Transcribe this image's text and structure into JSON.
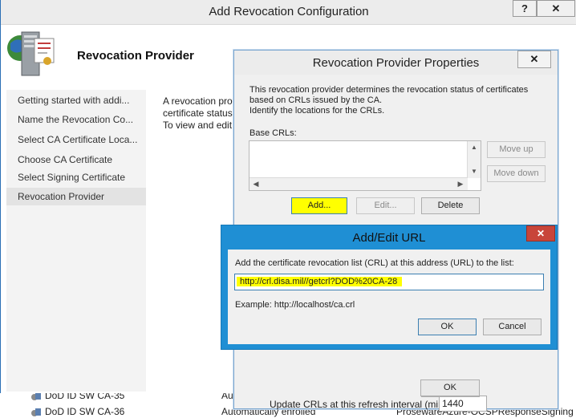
{
  "background_list": {
    "rows": [
      {
        "name": "DoD ID SW CA-35",
        "enrollment": "Au",
        "template": ""
      },
      {
        "name": "DoD ID SW CA-36",
        "enrollment": "Automatically enrolled",
        "template": "ProsewareAzure-OCSPResponseSigning"
      }
    ]
  },
  "wizard": {
    "title": "Add Revocation Configuration",
    "help_label": "?",
    "close_label": "✕",
    "header_title": "Revocation Provider",
    "nav": [
      "Getting started with addi...",
      "Name the Revocation Co...",
      "Select CA Certificate Loca...",
      "Choose CA Certificate",
      "Select Signing Certificate",
      "Revocation Provider"
    ],
    "body_lines": [
      "A revocation prov",
      "certificate status",
      "To view and edit"
    ]
  },
  "revocation_provider_properties": {
    "title": "Revocation Provider Properties",
    "close_label": "✕",
    "description": [
      "This revocation provider determines the revocation status of certificates",
      "based on CRLs issued by the CA.",
      "Identify the locations for the CRLs."
    ],
    "base_crls_label": "Base CRLs:",
    "move_up_label": "Move up",
    "move_down_label": "Move down",
    "add_label": "Add...",
    "edit_label": "Edit...",
    "delete_label": "Delete",
    "refresh_label": "Update CRLs at this refresh interval (min):",
    "refresh_value": "1440",
    "ok_label": "OK"
  },
  "add_edit_url": {
    "title": "Add/Edit URL",
    "close_label": "✕",
    "prompt": "Add the certificate revocation list (CRL) at this address (URL) to the list:",
    "url_value": "http://crl.disa.mil//getcrl?DOD%20CA-28",
    "example": "Example: http://localhost/ca.crl",
    "ok_label": "OK",
    "cancel_label": "Cancel"
  },
  "colors": {
    "dialog_accent": "#1f8fd4",
    "highlight": "#ffff00",
    "close_red": "#c8453a"
  }
}
